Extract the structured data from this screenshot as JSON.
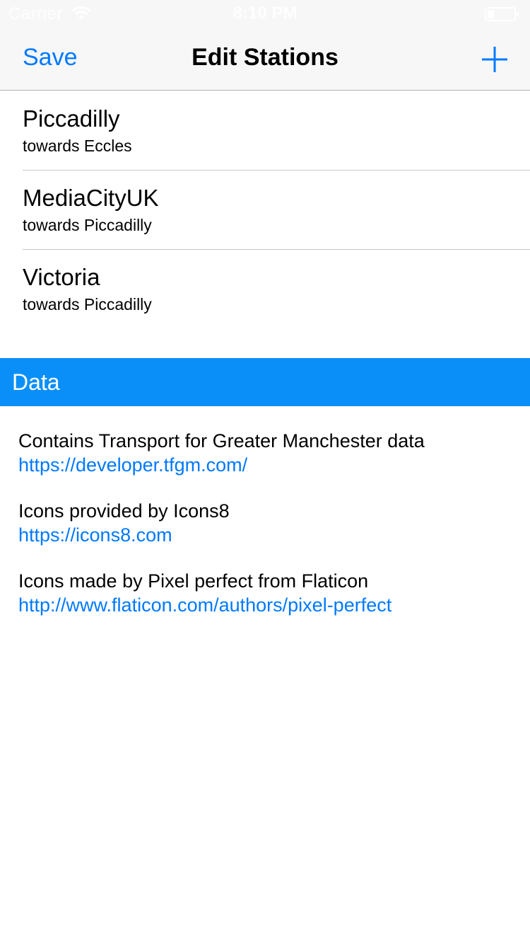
{
  "status_bar": {
    "carrier": "Carrier",
    "time": "8:10 PM",
    "wifi_icon": "wifi-icon",
    "battery_icon": "battery-icon"
  },
  "nav": {
    "save_label": "Save",
    "title": "Edit Stations",
    "add_icon": "plus-icon",
    "accent_color": "#0079ff"
  },
  "stations": [
    {
      "name": "Piccadilly",
      "direction": "towards Eccles"
    },
    {
      "name": "MediaCityUK",
      "direction": "towards Piccadilly"
    },
    {
      "name": "Victoria",
      "direction": "towards Piccadilly"
    }
  ],
  "data_section": {
    "header": "Data",
    "header_color": "#0a8ff9",
    "credits": [
      {
        "text": "Contains Transport for Greater Manchester data",
        "link": "https://developer.tfgm.com/"
      },
      {
        "text": "Icons provided by Icons8",
        "link": "https://icons8.com"
      },
      {
        "text": "Icons made by Pixel perfect from Flaticon",
        "link": "http://www.flaticon.com/authors/pixel-perfect"
      }
    ]
  }
}
